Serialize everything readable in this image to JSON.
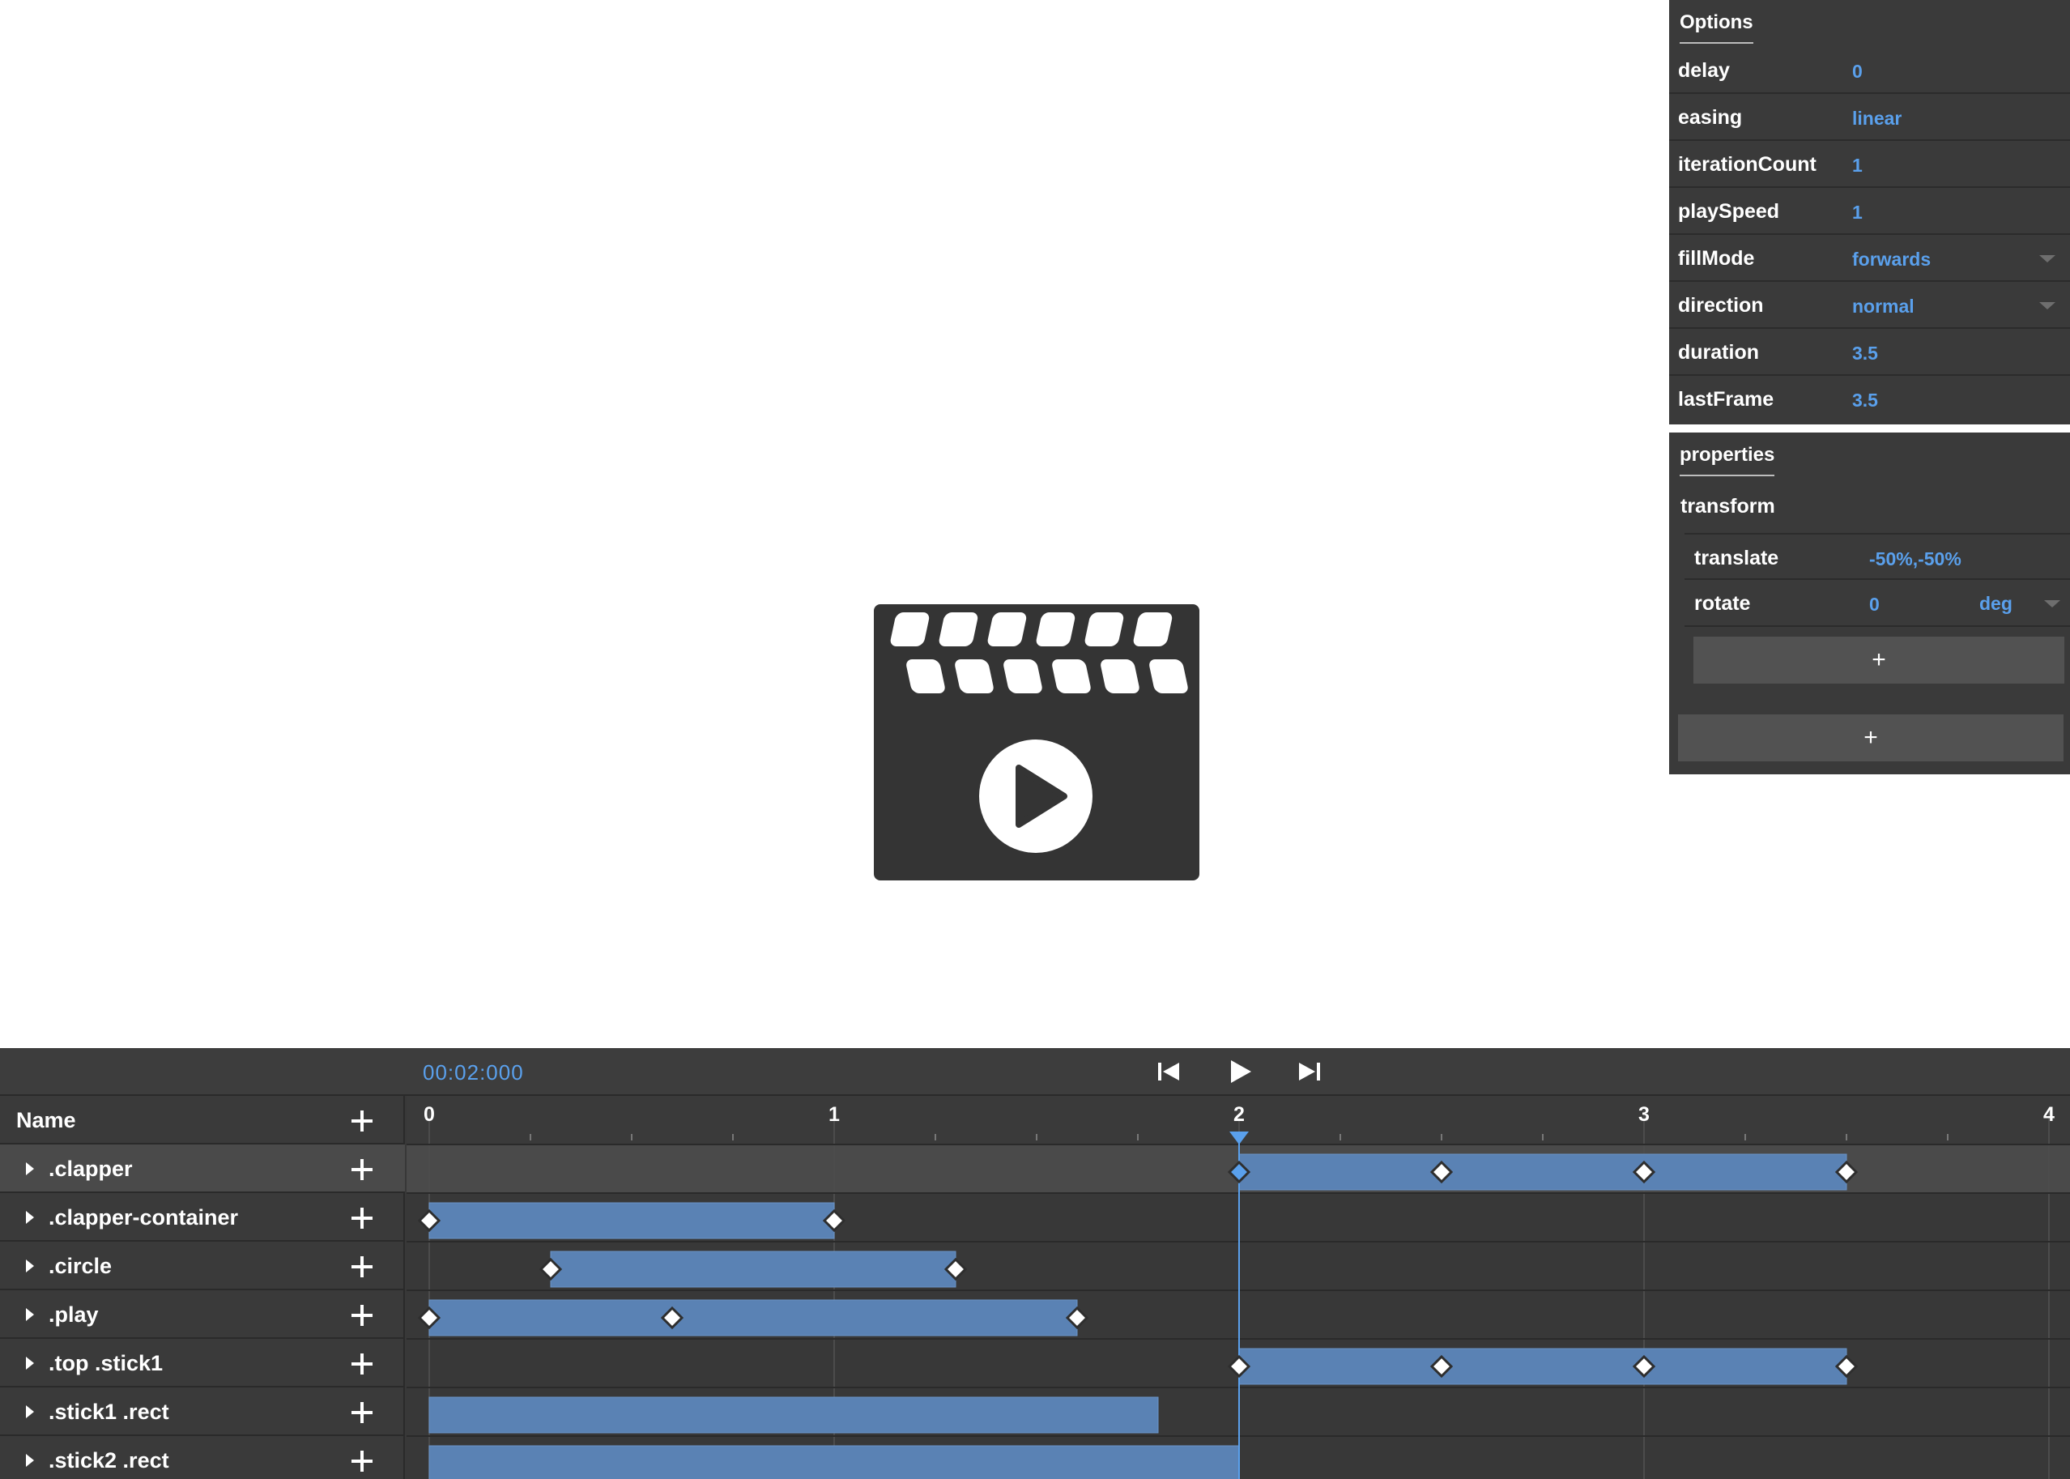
{
  "preview": {
    "icon": "clapperboard-play-icon"
  },
  "options": {
    "tab_label": "Options",
    "rows": [
      {
        "label": "delay",
        "value": "0"
      },
      {
        "label": "easing",
        "value": "linear"
      },
      {
        "label": "iterationCount",
        "value": "1"
      },
      {
        "label": "playSpeed",
        "value": "1"
      },
      {
        "label": "fillMode",
        "value": "forwards"
      },
      {
        "label": "direction",
        "value": "normal"
      },
      {
        "label": "duration",
        "value": "3.5"
      },
      {
        "label": "lastFrame",
        "value": "3.5"
      }
    ]
  },
  "properties": {
    "tab_label": "properties",
    "group_label": "transform",
    "rows": [
      {
        "label": "translate",
        "value": "-50%,-50%"
      },
      {
        "label": "rotate",
        "value": "0",
        "unit": "deg"
      }
    ],
    "add_property_label": "+",
    "add_group_label": "+"
  },
  "timeline": {
    "current_time": "00:02:000",
    "controls": {
      "prev": "skip-to-start-icon",
      "play": "play-icon",
      "next": "skip-to-end-icon"
    },
    "name_header": "Name",
    "ruler_labels": [
      "0",
      "1",
      "2",
      "3",
      "4"
    ],
    "playhead_time": 2,
    "layers": [
      {
        "name": ".clapper",
        "selected": true,
        "bars": [
          [
            2,
            3.5
          ]
        ],
        "keyframes": [
          2,
          2.5,
          3,
          3.5
        ],
        "active_keyframe": 2
      },
      {
        "name": ".clapper-container",
        "selected": false,
        "bars": [
          [
            0,
            1
          ]
        ],
        "keyframes": [
          0,
          1
        ]
      },
      {
        "name": ".circle",
        "selected": false,
        "bars": [
          [
            0.3,
            1.3
          ]
        ],
        "keyframes": [
          0.3,
          1.3
        ]
      },
      {
        "name": ".play",
        "selected": false,
        "bars": [
          [
            0,
            1.6
          ]
        ],
        "keyframes": [
          0,
          0.6,
          1.6
        ]
      },
      {
        "name": ".top .stick1",
        "selected": false,
        "bars": [
          [
            2,
            3.5
          ]
        ],
        "keyframes": [
          2,
          2.5,
          3,
          3.5
        ]
      },
      {
        "name": ".stick1 .rect",
        "selected": false,
        "bars": [
          [
            0,
            1.8
          ]
        ],
        "keyframes": []
      },
      {
        "name": ".stick2 .rect",
        "selected": false,
        "bars": [
          [
            0,
            2
          ]
        ],
        "keyframes": []
      }
    ],
    "colors": {
      "bar": "#5a82b4",
      "accent": "#5aa0ec",
      "keyframe": "#ffffff"
    }
  }
}
